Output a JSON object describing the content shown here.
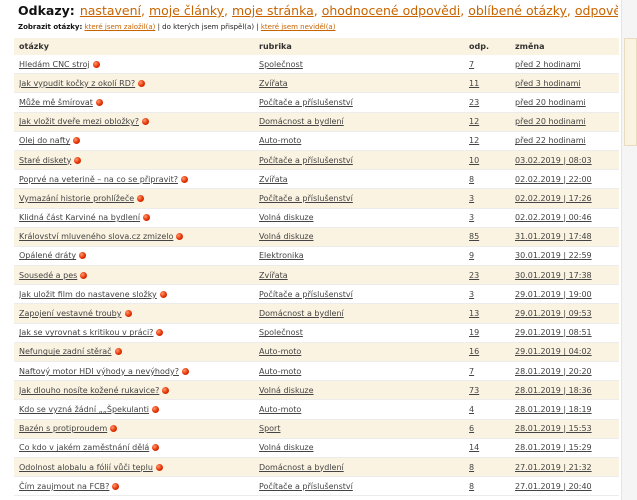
{
  "header": {
    "label": "Odkazy:",
    "links": [
      "nastavení",
      "moje články",
      "moje stránka",
      "ohodnocené odpovědi",
      "oblíbené otázky",
      "odpovědi na mail"
    ]
  },
  "filters": {
    "label": "Zobrazit otázky:",
    "link1": "které jsem založil(a)",
    "sep1": " | ",
    "text": "do kterých jsem přispěl(a)",
    "sep2": " | ",
    "link2": "které jsem neviděl(a)"
  },
  "table": {
    "columns": [
      "otázky",
      "rubrika",
      "odp.",
      "změna"
    ],
    "rows": [
      {
        "q": "Hledám CNC stroj",
        "r": "Společnost",
        "o": "7",
        "z": "před 2 hodinami"
      },
      {
        "q": "Jak vypudit kočky z okolí RD?",
        "r": "Zvířata",
        "o": "11",
        "z": "před 3 hodinami"
      },
      {
        "q": "Může mě šmírovat",
        "r": "Počítače a příslušenství",
        "o": "23",
        "z": "před 20 hodinami"
      },
      {
        "q": "Jak vložit dveře mezi obložky?",
        "r": "Domácnost a bydlení",
        "o": "12",
        "z": "před 20 hodinami"
      },
      {
        "q": "Olej do nafty",
        "r": "Auto-moto",
        "o": "12",
        "z": "před 22 hodinami"
      },
      {
        "q": "Staré diskety",
        "r": "Počítače a příslušenství",
        "o": "10",
        "z": "03.02.2019 | 08:03"
      },
      {
        "q": "Poprvé na veterině – na co se připravit?",
        "r": "Zvířata",
        "o": "8",
        "z": "02.02.2019 | 22:00"
      },
      {
        "q": "Vymazání historie prohlížeče",
        "r": "Počítače a příslušenství",
        "o": "3",
        "z": "02.02.2019 | 17:26"
      },
      {
        "q": "Klidná část Karviné na bydlení",
        "r": "Volná diskuze",
        "o": "3",
        "z": "02.02.2019 | 00:46"
      },
      {
        "q": "Království mluveného slova.cz zmizelo",
        "r": "Volná diskuze",
        "o": "85",
        "z": "31.01.2019 | 17:48"
      },
      {
        "q": "Opálené dráty",
        "r": "Elektronika",
        "o": "9",
        "z": "30.01.2019 | 22:59"
      },
      {
        "q": "Sousedé a pes",
        "r": "Zvířata",
        "o": "23",
        "z": "30.01.2019 | 17:38"
      },
      {
        "q": "Jak uložit film do nastavene složky",
        "r": "Počítače a příslušenství",
        "o": "3",
        "z": "29.01.2019 | 19:00"
      },
      {
        "q": "Zapojení vestavné trouby",
        "r": "Domácnost a bydlení",
        "o": "13",
        "z": "29.01.2019 | 09:53"
      },
      {
        "q": "Jak se vyrovnat s kritikou v práci?",
        "r": "Společnost",
        "o": "19",
        "z": "29.01.2019 | 08:51"
      },
      {
        "q": "Nefunguje zadní stěrač",
        "r": "Auto-moto",
        "o": "16",
        "z": "29.01.2019 | 04:02"
      },
      {
        "q": "Naftový motor HDI výhody a nevýhody?",
        "r": "Auto-moto",
        "o": "7",
        "z": "28.01.2019 | 20:20"
      },
      {
        "q": "Jak dlouho nosíte kožené rukavice?",
        "r": "Volná diskuze",
        "o": "73",
        "z": "28.01.2019 | 18:36"
      },
      {
        "q": "Kdo se vyzná žádní „„Špekulanti",
        "r": "Auto-moto",
        "o": "4",
        "z": "28.01.2019 | 18:19"
      },
      {
        "q": "Bazén s protiproudem",
        "r": "Sport",
        "o": "6",
        "z": "28.01.2019 | 15:53"
      },
      {
        "q": "Co kdo v jakém zaměstnání dělá",
        "r": "Volná diskuze",
        "o": "14",
        "z": "28.01.2019 | 15:29"
      },
      {
        "q": "Odolnost alobalu a fólií vůči teplu",
        "r": "Domácnost a bydlení",
        "o": "8",
        "z": "27.01.2019 | 21:32"
      },
      {
        "q": "Čím zaujmout na FCB?",
        "r": "Počítače a příslušenství",
        "o": "8",
        "z": "27.01.2019 | 20:40"
      }
    ]
  },
  "colors": {
    "link": "#c86400",
    "row_alt": "#fbf3e1",
    "dot": "#e53000"
  },
  "icons": {
    "new_answer": "red-dot-icon"
  }
}
